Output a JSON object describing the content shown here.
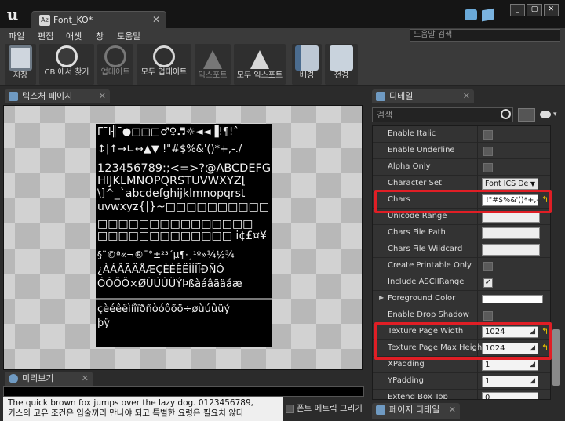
{
  "window": {
    "tab_label": "Font_KO*",
    "tab_icon_text": "Az",
    "controls": [
      "_",
      "▢",
      "✕"
    ]
  },
  "menu": [
    "파일",
    "편집",
    "애셋",
    "창",
    "도움말"
  ],
  "help_search_placeholder": "도움말 검색",
  "toolbar": [
    {
      "label": "저장",
      "icon": "save-icon",
      "disabled": false
    },
    {
      "label": "CB 에서 찾기",
      "icon": "magnifier-icon",
      "disabled": false
    },
    {
      "label": "업데이트",
      "icon": "update-icon",
      "disabled": true
    },
    {
      "label": "모두 업데이트",
      "icon": "update-all-icon",
      "disabled": false
    },
    {
      "label": "익스포트",
      "icon": "export-icon",
      "disabled": true
    },
    {
      "label": "모두 익스포트",
      "icon": "export-all-icon",
      "disabled": false
    },
    {
      "label": "배경",
      "icon": "background-icon",
      "disabled": false
    },
    {
      "label": "전경",
      "icon": "foreground-icon",
      "disabled": false
    }
  ],
  "texture_panel": {
    "tab": "텍스처 페이지",
    "atlas_lines": [
      "ΓˉⅠ╢ˉ●□□□♂♀♬☼◄◄▐!¶!ˆ",
      "↕|↑→∟↔▲▼ !\"#$%&'()*+,-./",
      "123456789:;<=>?@ABCDEFG",
      "HIJKLMNOPQRSTUVWXYZ[",
      "\\]^_`abcdefghijklmnopqrst",
      "uvwxyz{|}~□□□□□□□□□□",
      "□□□□□□□□□□□□□□□",
      "□□□□□□□□□□□□□ i¢£¤¥",
      "§¨©ª«¬­®¯°±²³´µ¶·¸¹º»¼½¾",
      "¿ÀÁÂÃÄÅÆÇÈÉÊËÌÍÎÏÐÑÒ",
      "ÓÔÕÖ×ØÙÚÛÜÝÞßàáâãäåæ",
      "çèéêëìíîïðñòóôõö÷øùúûüý",
      "þÿ"
    ]
  },
  "preview_panel": {
    "tab": "미리보기",
    "text_line1": "The quick brown fox jumps over the lazy dog. 0123456789,",
    "text_line2": "키스의 고유 조건은 입술끼리 만나야 되고 특별한 요령은 필요치 않다",
    "font_metrics_label": "폰트 메트릭 그리기"
  },
  "details_panel": {
    "tab": "디테일",
    "search_placeholder": "검색",
    "rows": [
      {
        "label": "Enable Italic",
        "kind": "checkbox",
        "checked": false
      },
      {
        "label": "Enable Underline",
        "kind": "checkbox",
        "checked": false
      },
      {
        "label": "Alpha Only",
        "kind": "checkbox",
        "checked": false
      },
      {
        "label": "Character Set",
        "kind": "dropdown",
        "value": "Font ICS De"
      },
      {
        "label": "Chars",
        "kind": "chars",
        "value": " !\"#$%&'()*+,-./"
      },
      {
        "label": "Unicode Range",
        "kind": "text",
        "value": ""
      },
      {
        "label": "Chars File Path",
        "kind": "text",
        "value": ""
      },
      {
        "label": "Chars File Wildcard",
        "kind": "text",
        "value": ""
      },
      {
        "label": "Create Printable Only",
        "kind": "checkbox",
        "checked": false
      },
      {
        "label": "Include ASCIIRange",
        "kind": "checkbox",
        "checked": true
      },
      {
        "label": "Foreground Color",
        "kind": "color",
        "value": "#ffffff"
      },
      {
        "label": "Enable Drop Shadow",
        "kind": "checkbox",
        "checked": false
      },
      {
        "label": "Texture Page Width",
        "kind": "number",
        "value": "1024"
      },
      {
        "label": "Texture Page Max Height",
        "kind": "number",
        "value": "1024"
      },
      {
        "label": "XPadding",
        "kind": "number",
        "value": "1"
      },
      {
        "label": "YPadding",
        "kind": "number",
        "value": "1"
      },
      {
        "label": "Extend Box Top",
        "kind": "number",
        "value": "0"
      }
    ]
  },
  "page_details_tab": "페이지 디테일",
  "colors": {
    "highlight": "#e01e25",
    "reset_arrow": "#e8c500"
  }
}
